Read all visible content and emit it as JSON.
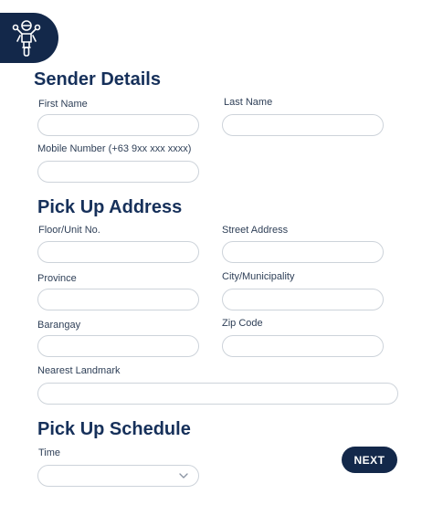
{
  "brand": {
    "logo_icon": "motorcycle-rider-icon",
    "badge_color": "#13284a"
  },
  "sender": {
    "title": "Sender Details",
    "first_name_label": "First Name",
    "last_name_label": "Last Name",
    "mobile_label": "Mobile Number (+63 9xx xxx xxxx)",
    "first_name_value": "",
    "last_name_value": "",
    "mobile_value": ""
  },
  "pickup_address": {
    "title": "Pick Up Address",
    "floor_label": "Floor/Unit No.",
    "street_label": "Street Address",
    "province_label": "Province",
    "city_label": "City/Municipality",
    "barangay_label": "Barangay",
    "zip_label": "Zip Code",
    "landmark_label": "Nearest Landmark",
    "floor_value": "",
    "street_value": "",
    "province_value": "",
    "city_value": "",
    "barangay_value": "",
    "zip_value": "",
    "landmark_value": ""
  },
  "pickup_schedule": {
    "title": "Pick Up Schedule",
    "time_label": "Time",
    "time_selected": "",
    "chevron_icon": "chevron-down-icon"
  },
  "actions": {
    "next_label": "NEXT",
    "primary_color": "#13284a"
  }
}
